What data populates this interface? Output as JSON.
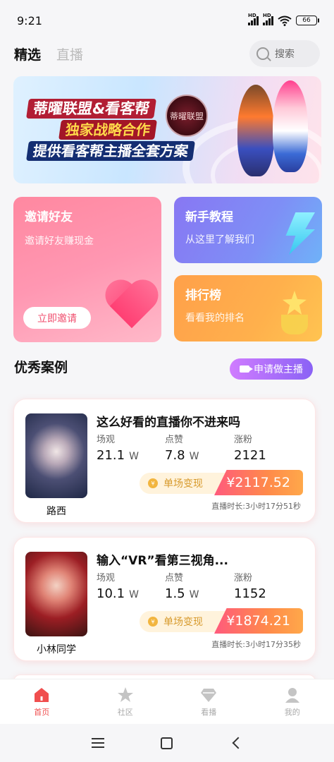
{
  "status_bar": {
    "time": "9:21",
    "battery": "66",
    "network_1": "HD",
    "network_2": "HD"
  },
  "top_tabs": [
    {
      "label": "精选"
    },
    {
      "label": "直播"
    }
  ],
  "search": {
    "placeholder": "搜索"
  },
  "banner": {
    "line1": "蒂曜联盟&看客帮",
    "line2": "独家战略合作",
    "line3": "提供看客帮主播全套方案",
    "logo_text": "蒂曜联盟"
  },
  "invite_card": {
    "title": "邀请好友",
    "subtitle": "邀请好友赚现金",
    "button": "立即邀请"
  },
  "tutorial_card": {
    "title": "新手教程",
    "subtitle": "从这里了解我们"
  },
  "rank_card": {
    "title": "排行榜",
    "subtitle": "看看我的排名"
  },
  "section": {
    "title": "优秀案例",
    "apply_button": "申请做主播"
  },
  "cases": [
    {
      "name": "路西",
      "title": "这么好看的直播你不进来吗",
      "stats": [
        {
          "label": "场观",
          "value": "21.1",
          "unit": "W"
        },
        {
          "label": "点赞",
          "value": "7.8",
          "unit": "W"
        },
        {
          "label": "涨粉",
          "value": "2121",
          "unit": ""
        }
      ],
      "earn_label": "单场变现",
      "earn_amount": "¥2117.52",
      "duration": "直播时长:3小时17分51秒"
    },
    {
      "name": "小林同学",
      "title": "输入“VR”看第三视角...",
      "stats": [
        {
          "label": "场观",
          "value": "10.1",
          "unit": "W"
        },
        {
          "label": "点赞",
          "value": "1.5",
          "unit": "W"
        },
        {
          "label": "涨粉",
          "value": "1152",
          "unit": ""
        }
      ],
      "earn_label": "单场变现",
      "earn_amount": "¥1874.21",
      "duration": "直播时长:3小时17分35秒"
    }
  ],
  "tabbar": [
    {
      "label": "首页",
      "icon": "home-icon"
    },
    {
      "label": "社区",
      "icon": "star-icon"
    },
    {
      "label": "看播",
      "icon": "diamond-icon"
    },
    {
      "label": "我的",
      "icon": "person-icon"
    }
  ],
  "colors": {
    "accent": "#f04e4e",
    "invite": "#ff88a0",
    "tutorial": "#8877f3",
    "rank": "#ffa04a"
  }
}
